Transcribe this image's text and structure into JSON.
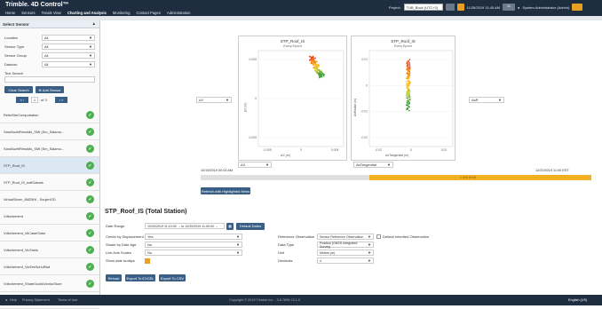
{
  "app": {
    "logo": "Trimble. 4D Control™"
  },
  "nav": [
    "Home",
    "Sensors",
    "Tenals View",
    "Charting and Analysis",
    "Monitoring",
    "Contact Pages",
    "Administration"
  ],
  "nav_active": 3,
  "project": {
    "label": "Project:",
    "value": "TUB_Bock (UTC+2)",
    "datetime": "11/26/2019 11:45 AM",
    "count": "11",
    "user": "System Administrator (Admin)"
  },
  "sidebar": {
    "title": "Select Sensor",
    "filters": [
      {
        "label": "Location",
        "value": "All"
      },
      {
        "label": "Sensor Type",
        "value": "All"
      },
      {
        "label": "Sensor Group",
        "value": "All"
      },
      {
        "label": "Datacsv",
        "value": "All"
      }
    ],
    "text_search_label": "Text Search",
    "clear_search": "Clear Search",
    "add_sensor": "Add Sensor",
    "page": "1",
    "of": "of 3",
    "sensors": [
      "RebsSterCompubation",
      "SaruBuzhtRessMs_SMI (Sm_Salamu...",
      "SaruBuzhtRessMs_SMI (Sm_Salamu...",
      "STP_Roof_IS",
      "STP_Roof_IS_eoffGabsts",
      "VirtualStorm_6M25HI - SoujeriOD",
      "Vdbchement",
      "Vdbchement_ViiCaselSutur",
      "Vdbchement_VioTablo",
      "Vdbchement_ViaTeeSchuRtwi",
      "Vdbchement_ShateGcubkVonkuSture",
      "Vdbchement_ShatuSpaSuWhmkms"
    ],
    "selected_index": 3
  },
  "charts": {
    "left": {
      "title": "STP_Roof_IS",
      "subtitle": "Every Epoch",
      "xlabel": "ΔX (m)",
      "ylabel": "ΔY (m)",
      "xticks": [
        "-0.005",
        "0",
        "0.005"
      ],
      "yticks": [
        "0.005",
        "0",
        "-0.005"
      ],
      "side_dropdown": "ΔY"
    },
    "right": {
      "title": "STP_Roof_IS",
      "subtitle": "Every Epoch",
      "xlabel": "ΔsTangential (m)",
      "ylabel": "ΔsRadial (m)",
      "xticks": [
        "-0.02",
        "0",
        "0.02"
      ],
      "yticks": [
        "0.01",
        "0",
        "-0.01",
        "-0.02"
      ],
      "side_dropdown": "ΔsR"
    },
    "x_dropdowns": [
      "ΔX",
      "ΔsTangential"
    ],
    "time_start": "10/19/2019 00:00 AM",
    "time_end": "12/20/2019 11:00 EST",
    "time_mid": "1 of 6 of 18",
    "refresh_button": "Refresh with Highlighted Items"
  },
  "details": {
    "title": "STP_Roof_IS (Total Station)",
    "date_range_label": "Date Range",
    "date_range_value": "10/20/2019 11:10:00 → to 12/20/2019 11:00:00 →",
    "default_dates": "Default Dates",
    "left_rows": [
      {
        "label": "Center by Displacement",
        "value": "Yes"
      },
      {
        "label": "Shade by Date Age",
        "value": "No"
      },
      {
        "label": "Link Axis Scales",
        "value": "No"
      },
      {
        "label": "Show date tooltips",
        "value": ""
      }
    ],
    "right_rows": [
      {
        "label": "Reference Observation",
        "value": "Sensor Reference Observation",
        "extra": "Default Inherited Observation"
      },
      {
        "label": "Data Type",
        "value": "Position (GNSS Integrated Survey)"
      },
      {
        "label": "Unit",
        "value": "Meters (m)"
      },
      {
        "label": "Decimals",
        "value": "4"
      }
    ],
    "buttons": [
      "Reload",
      "Export To EXCEL",
      "Export To CSV"
    ]
  },
  "footer": {
    "left": [
      "Help",
      "Privacy Statement",
      "Terms of Use"
    ],
    "center": "Copyright © 2019 Trimble Inc. - 5.8.7896.74.1.0",
    "right": "English (US)"
  },
  "colors": {
    "header": "#1e2d40",
    "accent": "#e8a020",
    "button": "#3a5f86",
    "status": "#4caf50"
  }
}
